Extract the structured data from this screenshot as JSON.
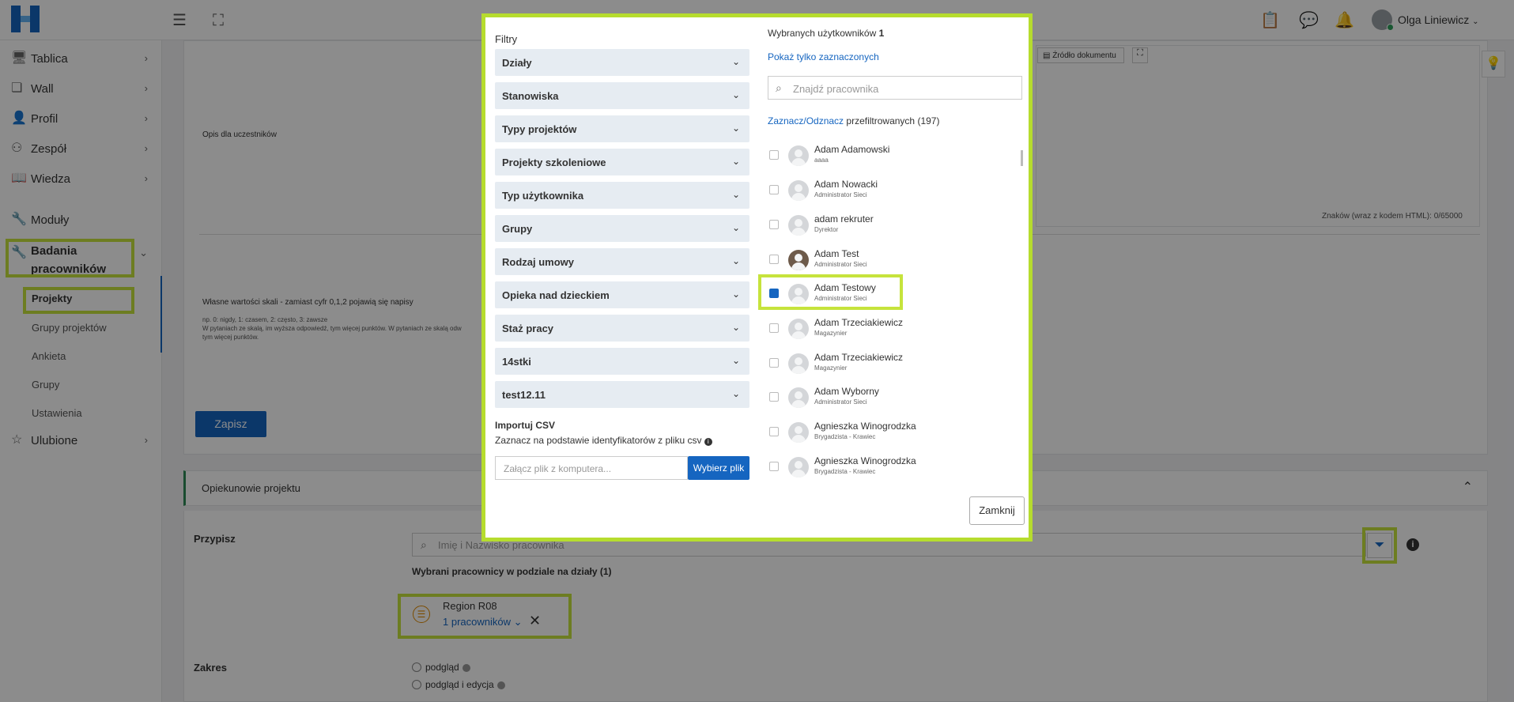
{
  "topbar": {
    "user_name": "Olga Liniewicz",
    "icons": [
      "menu-icon",
      "fullscreen-icon",
      "clipboard-icon",
      "chat-icon",
      "bell-icon"
    ]
  },
  "sidebar": {
    "items": [
      {
        "label": "Tablica",
        "icon": "monitor-icon"
      },
      {
        "label": "Wall",
        "icon": "wall-icon"
      },
      {
        "label": "Profil",
        "icon": "user-icon"
      },
      {
        "label": "Zespół",
        "icon": "team-icon"
      },
      {
        "label": "Wiedza",
        "icon": "book-icon"
      },
      {
        "label": "Moduły",
        "icon": "wrench-icon"
      },
      {
        "label_line1": "Badania",
        "label_line2": "pracowników",
        "icon": "wrench-icon"
      },
      {
        "label": "Ulubione",
        "icon": "star-icon"
      }
    ],
    "sub_items": [
      "Projekty",
      "Grupy projektów",
      "Ankieta",
      "Grupy",
      "Ustawienia"
    ]
  },
  "main": {
    "editor_toolbar": {
      "source_label": "Źródło dokumentu"
    },
    "description_label": "Opis dla uczestników",
    "char_counter": "Znaków (wraz z kodem HTML): 0/65000",
    "scale_label": "Własne wartości skali - zamiast cyfr 0,1,2 pojawią się napisy",
    "scale_help_1": "np. 0: nigdy, 1: czasem, 2: często, 3: zawsze",
    "scale_help_2": "W pytaniach ze skalą, im wyższa odpowiedź, tym więcej punktów. W pytaniach ze skalą odw",
    "scale_help_3": "tym więcej punktów.",
    "save_button": "Zapisz",
    "supervisors_section": "Opiekunowie projektu",
    "assign_label": "Przypisz",
    "search_placeholder": "Imię i Nazwisko pracownika",
    "selected_heading": "Wybrani pracownicy w podziale na działy (1)",
    "region_name": "Region R08",
    "region_count": "1 pracowników",
    "scope_label": "Zakres",
    "scope_options": [
      "podgląd",
      "podgląd i edycja"
    ]
  },
  "modal": {
    "filters_title": "Filtry",
    "filters": [
      "Działy",
      "Stanowiska",
      "Typy projektów",
      "Projekty szkoleniowe",
      "Typ użytkownika",
      "Grupy",
      "Rodzaj umowy",
      "Opieka nad dzieckiem",
      "Staż pracy",
      "14stki",
      "test12.11"
    ],
    "import_title": "Importuj CSV",
    "import_desc": "Zaznacz na podstawie identyfikatorów z pliku csv",
    "file_placeholder": "Załącz plik z komputera...",
    "choose_file": "Wybierz plik",
    "selected_users_label": "Wybranych użytkowników",
    "selected_users_count": "1",
    "show_selected_link": "Pokaż tylko zaznaczonych",
    "find_placeholder": "Znajdź pracownika",
    "select_link": "Zaznacz",
    "slash": "/",
    "deselect_link": "Odznacz",
    "filtered_text": "przefiltrowanych (197)",
    "users": [
      {
        "name": "Adam Adamowski",
        "role": "aaaa",
        "checked": false
      },
      {
        "name": "Adam Nowacki",
        "role": "Administrator Sieci",
        "checked": false
      },
      {
        "name": "adam rekruter",
        "role": "Dyrektor",
        "checked": false
      },
      {
        "name": "Adam Test",
        "role": "Administrator Sieci",
        "checked": false
      },
      {
        "name": "Adam Testowy",
        "role": "Administrator Sieci",
        "checked": true
      },
      {
        "name": "Adam Trzeciakiewicz",
        "role": "Magazynier",
        "checked": false
      },
      {
        "name": "Adam Trzeciakiewicz",
        "role": "Magazynier",
        "checked": false
      },
      {
        "name": "Adam Wyborny",
        "role": "Administrator Sieci",
        "checked": false
      },
      {
        "name": "Agnieszka Winogrodzka",
        "role": "Brygadzista - Krawiec",
        "checked": false
      },
      {
        "name": "Agnieszka Winogrodzka",
        "role": "Brygadzista - Krawiec",
        "checked": false
      }
    ],
    "close_button": "Zamknij"
  }
}
